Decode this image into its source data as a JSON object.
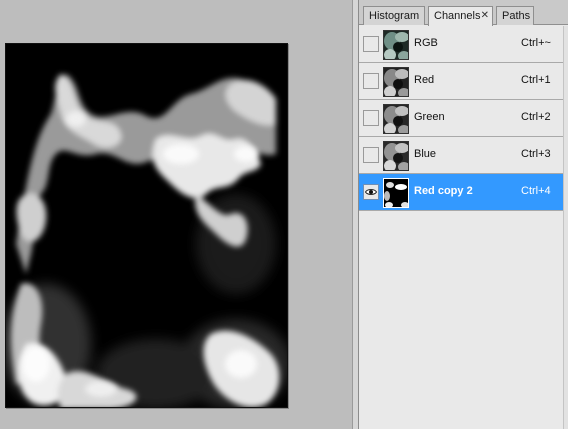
{
  "panel": {
    "tabs": [
      {
        "label": "Histogram",
        "active": false
      },
      {
        "label": "Channels",
        "active": true,
        "close": "✕"
      },
      {
        "label": "Paths",
        "active": false
      }
    ],
    "channels": [
      {
        "name": "RGB",
        "shortcut": "Ctrl+~",
        "visible": false,
        "selected": false,
        "thumb": "color-clouds"
      },
      {
        "name": "Red",
        "shortcut": "Ctrl+1",
        "visible": false,
        "selected": false,
        "thumb": "gray-clouds"
      },
      {
        "name": "Green",
        "shortcut": "Ctrl+2",
        "visible": false,
        "selected": false,
        "thumb": "gray-clouds"
      },
      {
        "name": "Blue",
        "shortcut": "Ctrl+3",
        "visible": false,
        "selected": false,
        "thumb": "gray-clouds"
      },
      {
        "name": "Red copy 2",
        "shortcut": "Ctrl+4",
        "visible": true,
        "selected": true,
        "thumb": "high-contrast-clouds"
      }
    ]
  },
  "colors": {
    "selection": "#3399ff",
    "panel_bg": "#e9e9e9",
    "canvas_bg": "#bdbdbd",
    "document_bg": "#000000"
  },
  "document": {
    "content": "black and white cloud channel image"
  }
}
